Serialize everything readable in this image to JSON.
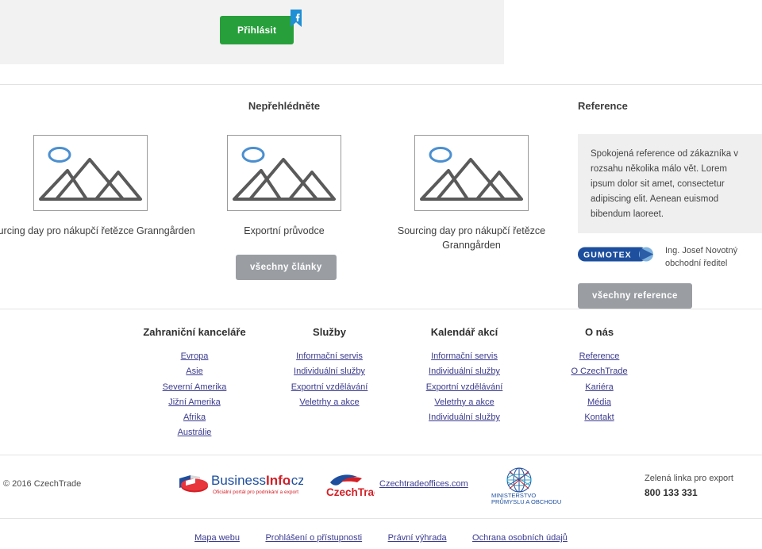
{
  "topbar": {
    "login_label": "Přihlásit",
    "facebook_icon": "facebook-flag-icon",
    "brand_green": "#27a03c",
    "facebook_blue": "#1f8fd6"
  },
  "articles": {
    "heading": "Nepřehlédněte",
    "all_button": "všechny články",
    "cards": [
      {
        "caption": "Sourcing day pro nákupčí řetězce Granngården",
        "image": "image-placeholder-mountains"
      },
      {
        "caption": "Exportní průvodce",
        "image": "image-placeholder-mountains"
      },
      {
        "caption": "Sourcing day pro nákupčí řetězce Granngården",
        "image": "image-placeholder-mountains"
      }
    ]
  },
  "reference": {
    "heading": "Reference",
    "quote": "Spokojená reference od zákazníka v rozsahu několika málo vět. Lorem ipsum dolor sit amet, consectetur adipiscing elit. Aenean euismod bibendum laoreet.",
    "company_logo": "GUMOTEX",
    "author_name": "Ing. Josef Novotný",
    "author_role": "obchodní ředitel",
    "all_button": "všechny reference",
    "logo_blue": "#1d4f9e"
  },
  "footer_nav": {
    "columns": [
      {
        "title": "Zahraniční kanceláře",
        "links": [
          "Evropa",
          "Asie",
          "Severní Amerika",
          "Jižní Amerika",
          "Afrika",
          "Austrálie"
        ]
      },
      {
        "title": "Služby",
        "links": [
          "Informační servis",
          "Individuální služby",
          "Exportní vzdělávání",
          "Veletrhy a akce"
        ]
      },
      {
        "title": "Kalendář akcí",
        "links": [
          "Informační servis",
          "Individuální služby",
          "Exportní vzdělávání",
          "Veletrhy a akce",
          "Individuální služby"
        ]
      },
      {
        "title": "O nás",
        "links": [
          "Reference",
          "O CzechTrade",
          "Kariéra",
          "Média",
          "Kontakt"
        ]
      }
    ]
  },
  "footer_bottom": {
    "copyright": "© 2016 CzechTrade",
    "logos": {
      "businessinfo_name": "BusinessInfo.cz",
      "businessinfo_tagline": "Oficiální portál pro podnikání a export",
      "czechtrade_name": "CzechTrade",
      "czechtradeoffices_link": "Czechtradeoffices.com",
      "ministry_line1": "MINISTERSTVO",
      "ministry_line2": "PRŮMYSLU A OBCHODU"
    },
    "hotline_label": "Zelená linka pro export",
    "hotline_number": "800 133 331",
    "legal_links": [
      "Mapa webu",
      "Prohlášení o přístupnosti",
      "Právní výhrada",
      "Ochrana osobních údajů"
    ]
  }
}
